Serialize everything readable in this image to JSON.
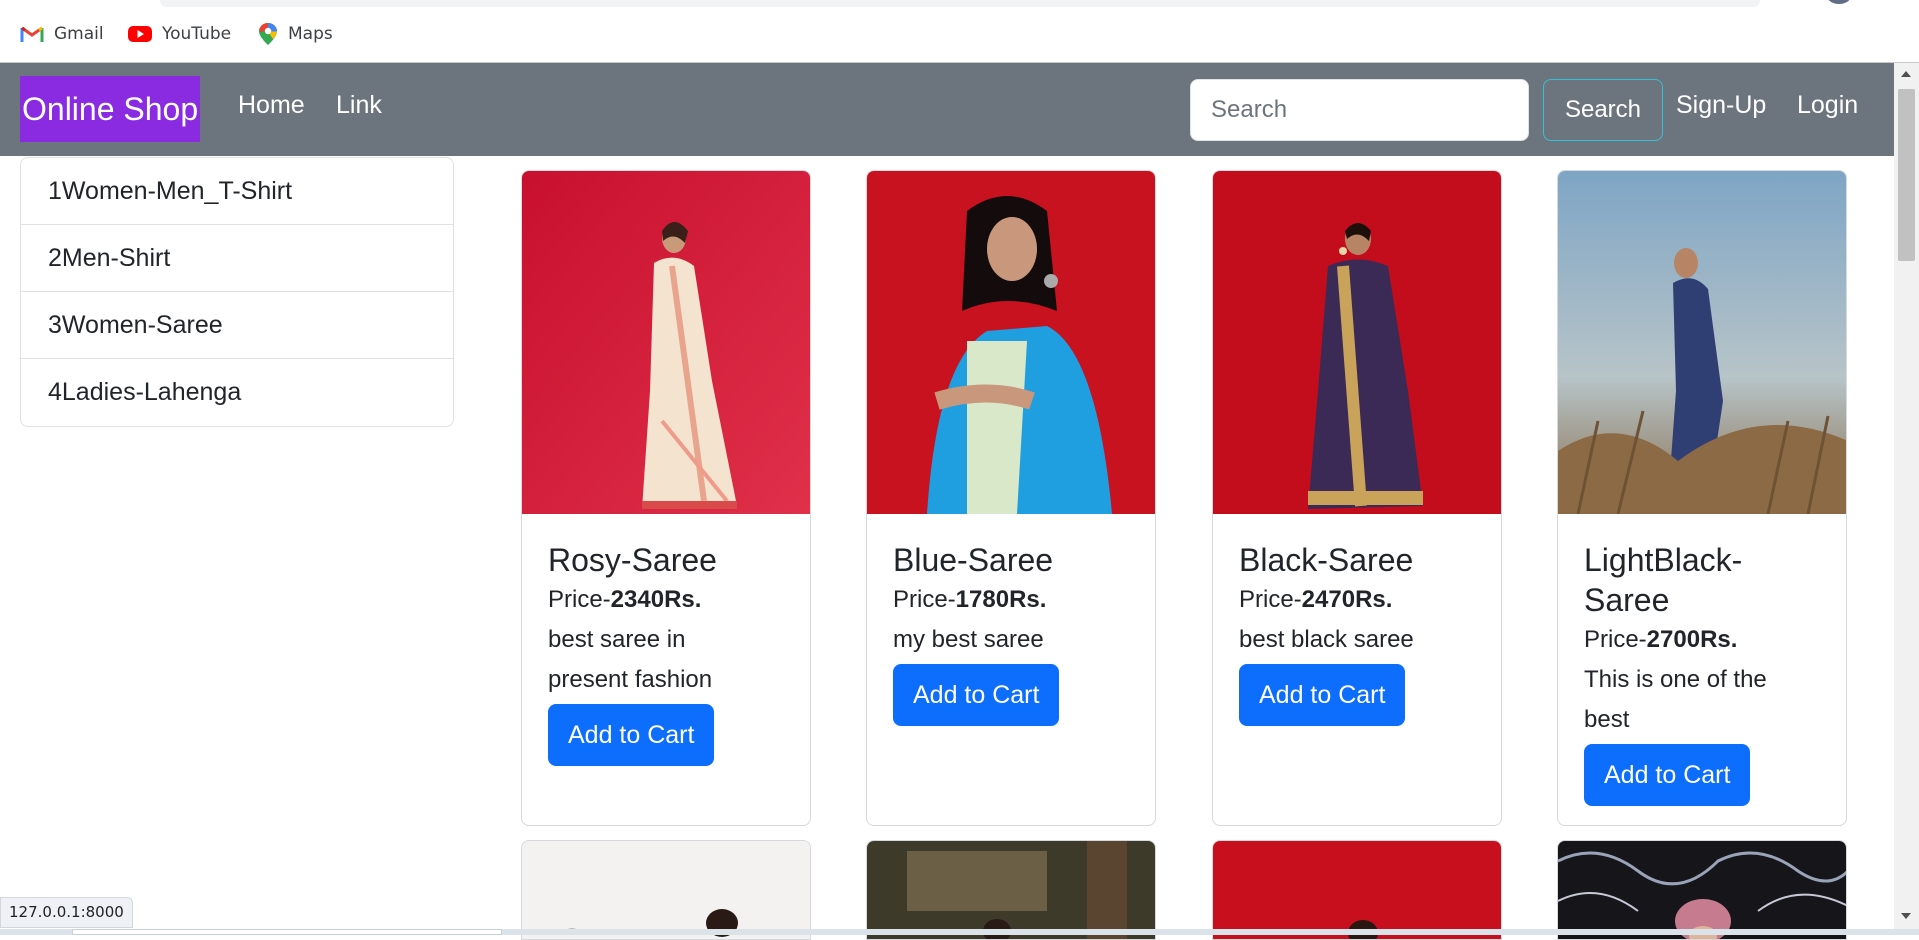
{
  "bookmarks": [
    {
      "label": "Gmail",
      "icon": "gmail-icon"
    },
    {
      "label": "YouTube",
      "icon": "youtube-icon"
    },
    {
      "label": "Maps",
      "icon": "maps-icon"
    }
  ],
  "navbar": {
    "brand": "Online Shop",
    "brand_color": "#8a2be2",
    "background": "#6c757d",
    "links": [
      "Home",
      "Link"
    ],
    "search_placeholder": "Search",
    "search_button": "Search",
    "signup": "Sign-Up",
    "login": "Login"
  },
  "categories": [
    "1Women-Men_T-Shirt",
    "2Men-Shirt",
    "3Women-Saree",
    "4Ladies-Lahenga"
  ],
  "products": [
    {
      "name": "Rosy-Saree",
      "price_prefix": "Price-",
      "price": "2340Rs.",
      "desc": "best saree in present fashion",
      "button": "Add to Cart"
    },
    {
      "name": "Blue-Saree",
      "price_prefix": "Price-",
      "price": "1780Rs.",
      "desc": "my best saree",
      "button": "Add to Cart"
    },
    {
      "name": "Black-Saree",
      "price_prefix": "Price-",
      "price": "2470Rs.",
      "desc": "best black saree",
      "button": "Add to Cart"
    },
    {
      "name": "LightBlack-Saree",
      "price_prefix": "Price-",
      "price": "2700Rs.",
      "desc": "This is one of the best",
      "button": "Add to Cart"
    }
  ],
  "accent": "#0d6efd",
  "status_url": "127.0.0.1:8000"
}
